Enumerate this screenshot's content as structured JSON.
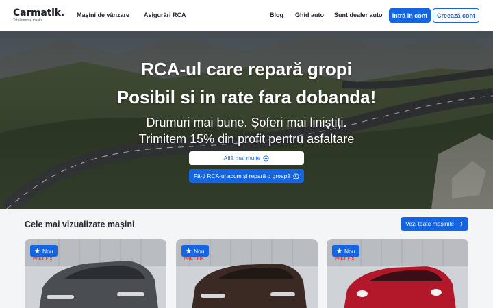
{
  "header": {
    "logo": {
      "name": "Carmatik.",
      "tagline": "Totul despre mașini"
    },
    "nav": [
      {
        "label": "Mașini de vânzare"
      },
      {
        "label": "Asigurări RCA"
      },
      {
        "label": "Blog"
      },
      {
        "label": "Ghid auto"
      },
      {
        "label": "Sunt dealer auto"
      }
    ],
    "login_label": "Intră în cont",
    "signup_label": "Creează cont"
  },
  "hero": {
    "title_line1": "RCA-ul care repară gropi",
    "title_line2": "Posibil si in rate fara dobanda!",
    "subtitle_line1": "Drumuri mai bune. Șoferi mai liniștiți.",
    "subtitle_line2": "Trimitem 15% din profit pentru asfaltare",
    "learn_more_label": "Află mai multe",
    "cta_label": "Fă-ți RCA-ul acum și repară o groapă",
    "icons": [
      "plus-circle-icon",
      "whatsapp-icon"
    ]
  },
  "most_viewed": {
    "title": "Cele mai vizualizate mașini",
    "view_all_label": "Vezi toate mașinile",
    "view_all_icon": "arrow-right-icon",
    "cars": [
      {
        "badge": "Nou",
        "badge_icon": "star-icon",
        "promo_text": "PRET FIX",
        "color": "#4a4d52"
      },
      {
        "badge": "Nou",
        "badge_icon": "star-icon",
        "promo_text": "PRET FIX",
        "color": "#3b2a24"
      },
      {
        "badge": "Nou",
        "badge_icon": "star-icon",
        "promo_text": "PRET FIX",
        "color": "#b3182a"
      }
    ]
  },
  "colors": {
    "accent": "#1565e0",
    "section_bg": "#f4f5f7"
  }
}
